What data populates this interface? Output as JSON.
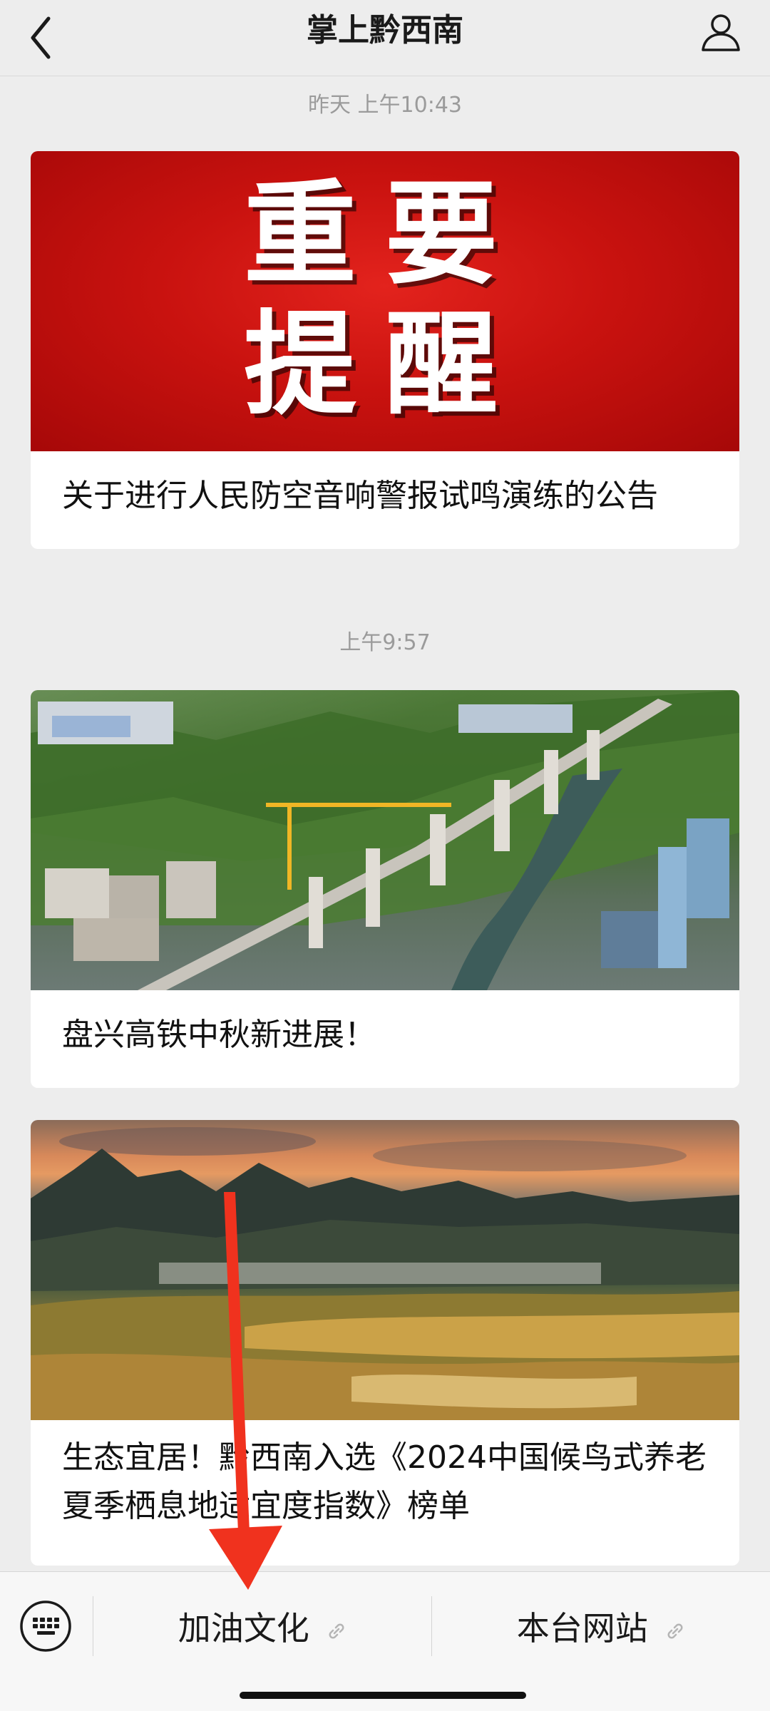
{
  "header": {
    "title": "掌上黔西南"
  },
  "messages": [
    {
      "time": "昨天 上午10:43",
      "image_text_line1": "重要",
      "image_text_line2": "提醒",
      "caption": "关于进行人民防空音响警报试鸣演练的公告"
    },
    {
      "time": "上午9:57",
      "caption": "盘兴高铁中秋新进展！"
    },
    {
      "caption": "生态宜居！黔西南入选《2024中国候鸟式养老夏季栖息地适宜度指数》榜单"
    }
  ],
  "bottom_menu": {
    "items": [
      {
        "label": "加油文化",
        "icon": "link-icon"
      },
      {
        "label": "本台网站",
        "icon": "link-icon"
      }
    ],
    "keyboard_icon": "keyboard-icon"
  },
  "colors": {
    "background": "#ededed",
    "banner_red": "#c9120f",
    "arrow_red": "#f0321e"
  }
}
